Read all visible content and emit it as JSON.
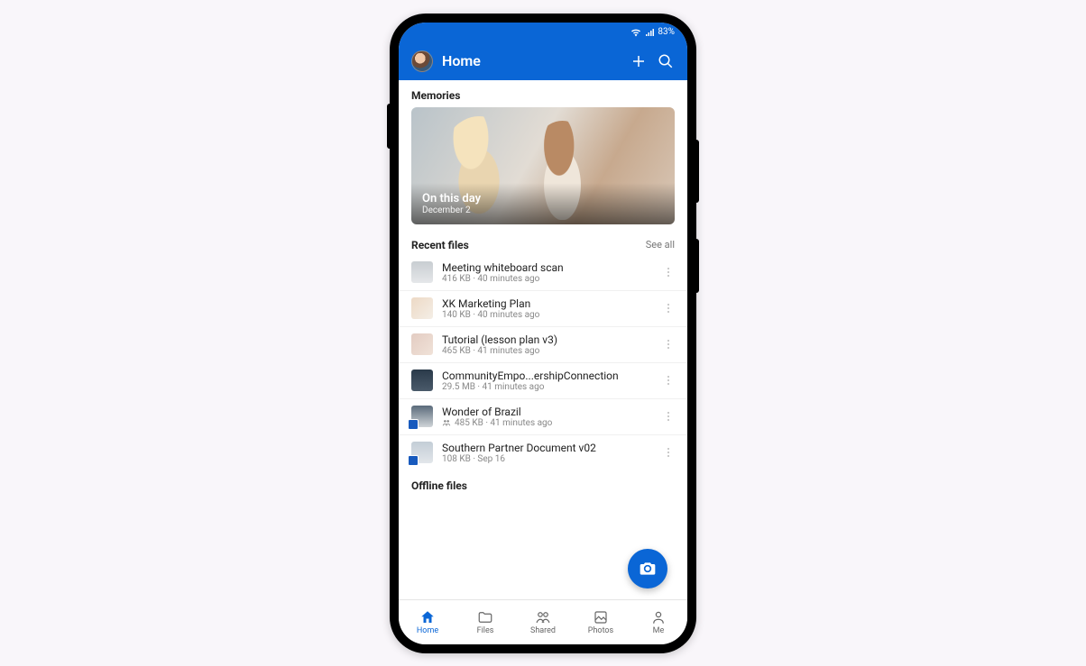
{
  "statusbar": {
    "battery": "83%"
  },
  "appbar": {
    "title": "Home"
  },
  "memories": {
    "section_label": "Memories",
    "card": {
      "title": "On this day",
      "subtitle": "December 2"
    }
  },
  "recent": {
    "section_label": "Recent files",
    "see_all": "See all",
    "files": [
      {
        "name": "Meeting whiteboard scan",
        "size": "416 KB",
        "time": "40 minutes ago",
        "thumb": "tA"
      },
      {
        "name": "XK Marketing Plan",
        "size": "140 KB",
        "time": "40 minutes ago",
        "thumb": "tB"
      },
      {
        "name": "Tutorial (lesson plan v3)",
        "size": "465 KB",
        "time": "41 minutes ago",
        "thumb": "tC"
      },
      {
        "name": "CommunityEmpo...ershipConnection",
        "size": "29.5 MB",
        "time": "41 minutes ago",
        "thumb": "tD"
      },
      {
        "name": "Wonder of Brazil",
        "size": "485 KB",
        "time": "41 minutes ago",
        "thumb": "tE",
        "shared": true,
        "badge": true
      },
      {
        "name": "Southern Partner Document v02",
        "size": "108 KB",
        "time": "Sep 16",
        "thumb": "tF",
        "badge": true
      }
    ]
  },
  "offline": {
    "section_label": "Offline files"
  },
  "nav": {
    "items": [
      {
        "label": "Home",
        "active": true
      },
      {
        "label": "Files"
      },
      {
        "label": "Shared"
      },
      {
        "label": "Photos"
      },
      {
        "label": "Me"
      }
    ]
  }
}
